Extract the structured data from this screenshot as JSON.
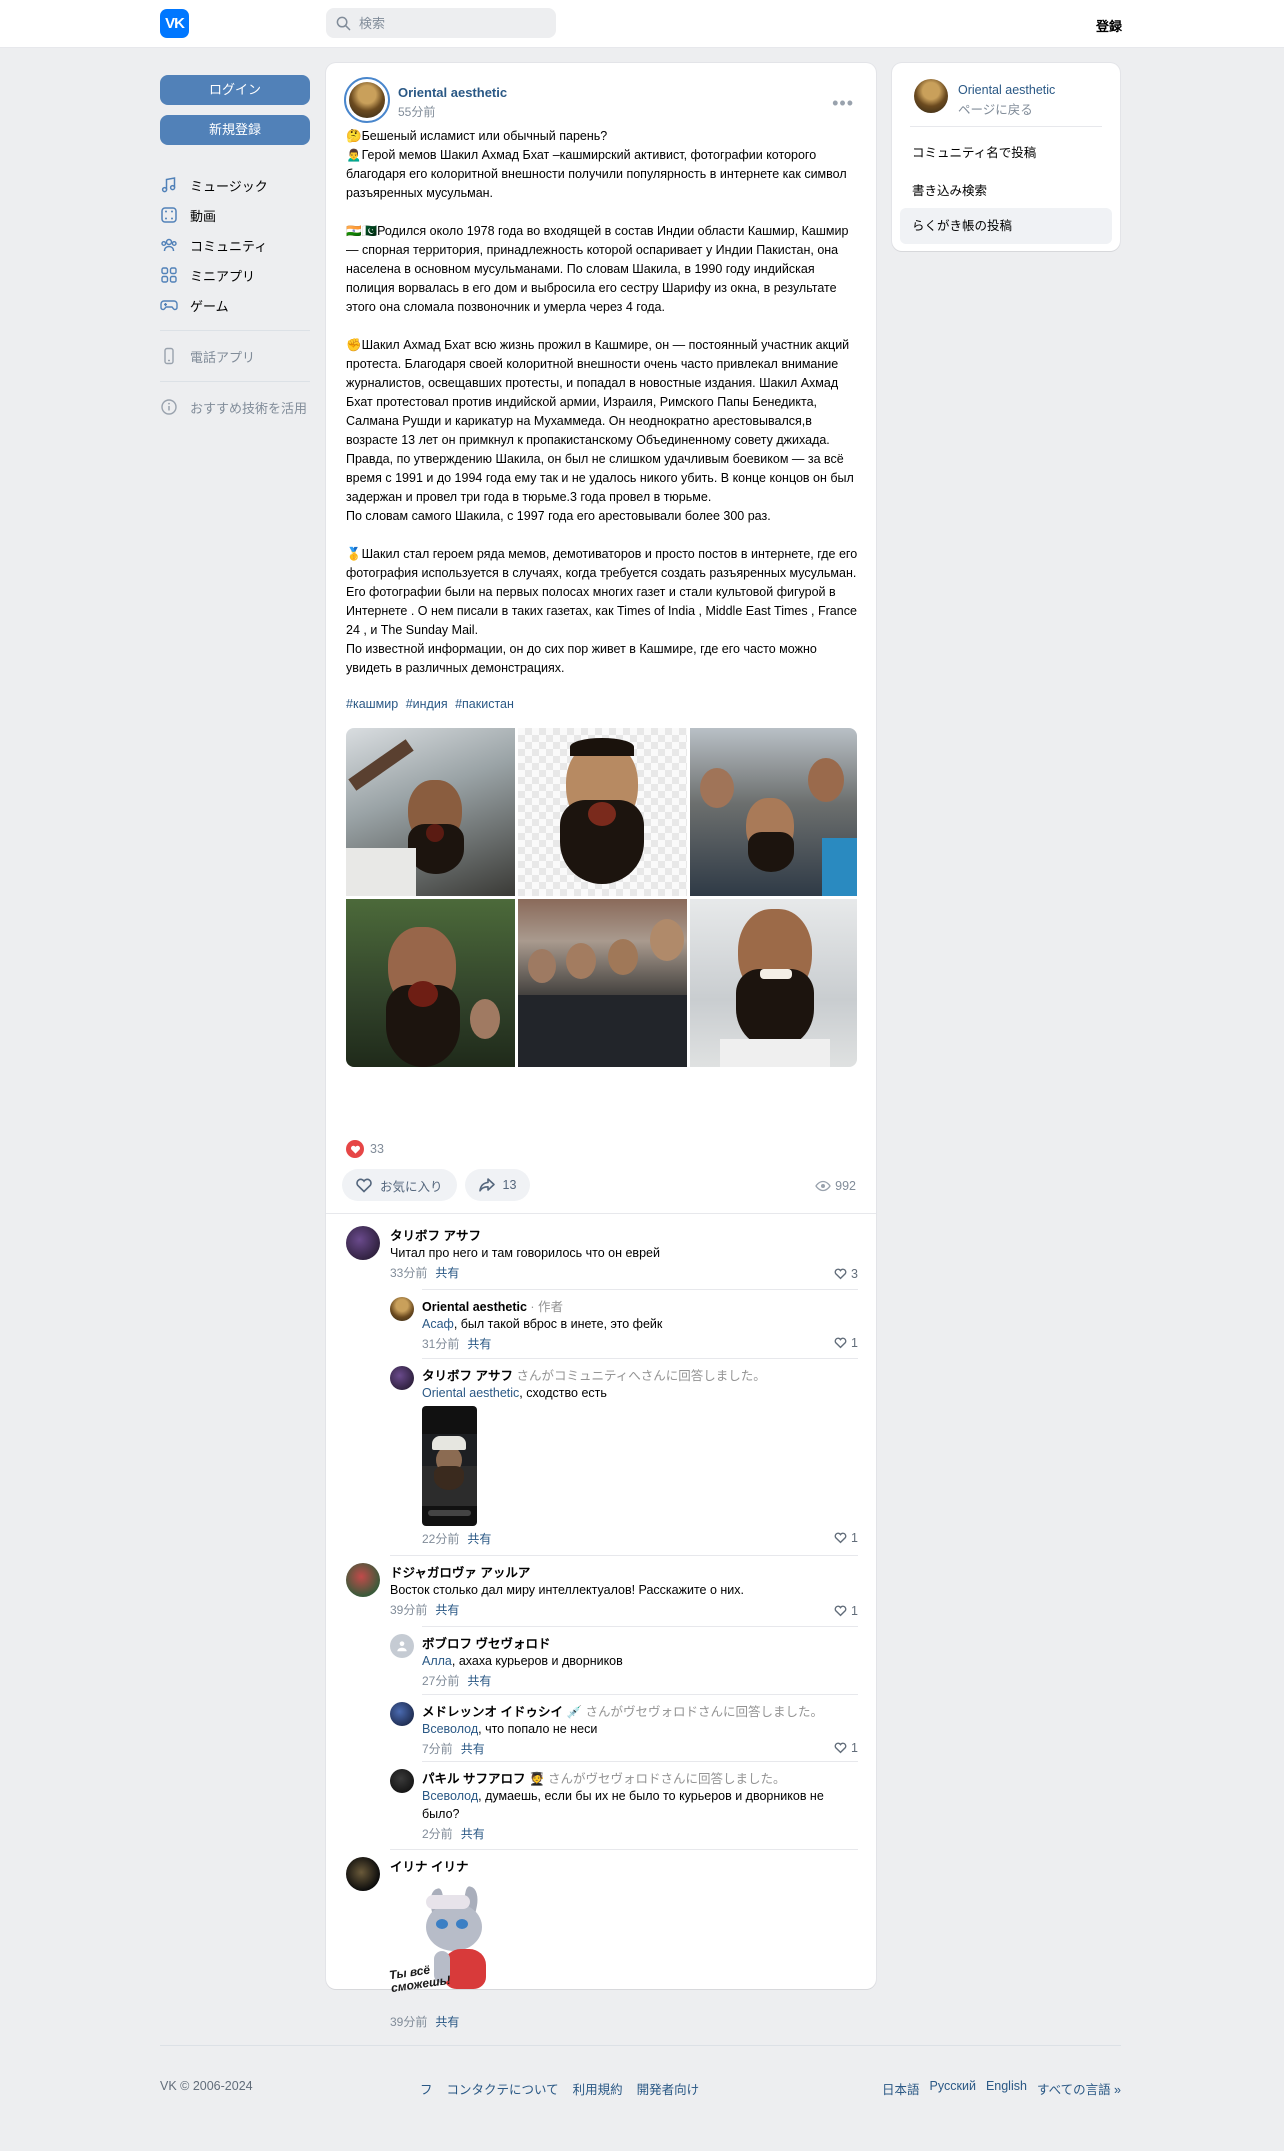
{
  "header": {
    "logo_text": "VK",
    "search_placeholder": "検索",
    "register_label": "登録"
  },
  "leftnav": {
    "login_label": "ログイン",
    "signup_label": "新規登録",
    "items": [
      {
        "label": "ミュージック",
        "icon": "music-icon"
      },
      {
        "label": "動画",
        "icon": "video-icon"
      },
      {
        "label": "コミュニティ",
        "icon": "community-icon"
      },
      {
        "label": "ミニアプリ",
        "icon": "mini-apps-icon"
      },
      {
        "label": "ゲーム",
        "icon": "gamepad-icon"
      }
    ],
    "secondary": [
      {
        "label": "電話アプリ",
        "icon": "phone-icon"
      },
      {
        "label": "おすすめ技術を活用",
        "icon": "info-icon"
      }
    ]
  },
  "post": {
    "author": "Oriental aesthetic",
    "time": "55分前",
    "text": "🤔Бешеный исламист или обычный парень?\n🙍‍♂️Герой мемов Шакил Ахмад Бхат –кашмирский активист, фотографии которого благодаря его колоритной внешности получили популярность в интернете как символ разъяренных мусульман.\n\n🇮🇳🇵🇰Родился около 1978 года во входящей в состав Индии области Кашмир, Кашмир — спорная территория, принадлежность которой оспаривает у Индии Пакистан, она населена в основном мусульманами. По словам Шакила, в 1990 году индийская полиция ворвалась в его дом и выбросила его сестру Шарифу из окна, в результате этого она сломала позвоночник и умерла через 4 года.\n\n✊Шакил Ахмад Бхат всю жизнь прожил в Кашмире, он — постоянный участник акций протеста. Благодаря своей колоритной внешности очень часто привлекал внимание журналистов, освещавших протесты, и попадал в новостные издания. Шакил Ахмад Бхат протестовал против индийской армии, Израиля, Римского Папы Бенедикта, Салмана Рушди и карикатур на Мухаммеда. Он неоднократно арестовывался,в возрасте 13 лет он примкнул к пропакистанскому Объединенному совету джихада. Правда, по утверждению Шакила, он был не слишком удачливым боевиком — за всё время с 1991 и до 1994 года ему так и не удалось никого убить. В конце концов он был задержан и провел три года в тюрьме.3 года провел в тюрьме.\nПо словам самого Шакила, с 1997 года его арестовывали более 300 раз.\n\n🥇Шакил стал героем ряда мемов, демотиваторов и просто постов в интернете, где его фотография используется в случаях, когда требуется создать разъяренных мусульман. Его фотографии были на первых полосах многих газет и стали культовой фигурой в Интернете . О нем писали в таких газетах, как Times of India , Middle East Times , France 24 , и The Sunday Mail.\nПо известной информации, он до сих пор живет в Кашмире, где его часто можно увидеть в различных демонстрациях.",
    "hashtags": [
      "#кашмир",
      "#индия",
      "#пакистан"
    ],
    "likes": "33",
    "favorite_label": "お気に入り",
    "shares": "13",
    "views": "992"
  },
  "comments": [
    {
      "name": "タリボフ アサフ",
      "text": "Читал про него и там говорилось что он еврей",
      "time": "33分前",
      "share": "共有",
      "likes": "3"
    },
    {
      "name": "Oriental aesthetic",
      "meta": " · 作者",
      "mention": "Асаф",
      "text": ", был такой вброс в инете, это фейк",
      "time": "31分前",
      "share": "共有",
      "likes": "1"
    },
    {
      "name": "タリボフ アサフ",
      "meta": " さんがコミュニティへさんに回答しました。",
      "mention": "Oriental aesthetic",
      "text": ", сходство есть",
      "time": "22分前",
      "share": "共有",
      "likes": "1"
    },
    {
      "name": "ドジャガロヴァ アッルア",
      "text": "Восток столько дал миру интеллектуалов! Расскажите о них.",
      "time": "39分前",
      "share": "共有",
      "likes": "1"
    },
    {
      "name": "ボブロフ ヴセヴォロド",
      "mention": "Алла",
      "text": ", ахаха курьеров и дворников",
      "time": "27分前",
      "share": "共有"
    },
    {
      "name": "メドレッンオ イドゥシイ",
      "meta": " 💉 さんがヴセヴォロドさんに回答しました。",
      "mention": "Всеволод",
      "text": ", что попало не неси",
      "time": "7分前",
      "share": "共有",
      "likes": "1"
    },
    {
      "name": "パキル サフアロフ",
      "meta": " 🧑‍🎓 さんがヴセヴォロドさんに回答しました。",
      "mention": "Всеволод",
      "text": ", думаешь, если бы их не было то курьеров и дворников не было?",
      "time": "2分前",
      "share": "共有"
    },
    {
      "name": "イリナ イリナ",
      "sticker_text": "Ты всё сможешь!",
      "time": "39分前",
      "share": "共有"
    }
  ],
  "right_panel": {
    "name": "Oriental aesthetic",
    "back": "ページに戻る",
    "items": [
      "コミュニティ名で投稿",
      "書き込み検索",
      "らくがき帳の投稿"
    ]
  },
  "footer": {
    "copyright": "VK © 2006-2024",
    "links": [
      "フ",
      "コンタクテについて",
      "利用規約",
      "開発者向け"
    ],
    "languages": [
      "日本語",
      "Русский",
      "English",
      "すべての言語 »"
    ]
  },
  "colors": {
    "accent": "#2a5885",
    "button": "#5181b8",
    "like": "#e64646",
    "background": "#edeef0"
  }
}
